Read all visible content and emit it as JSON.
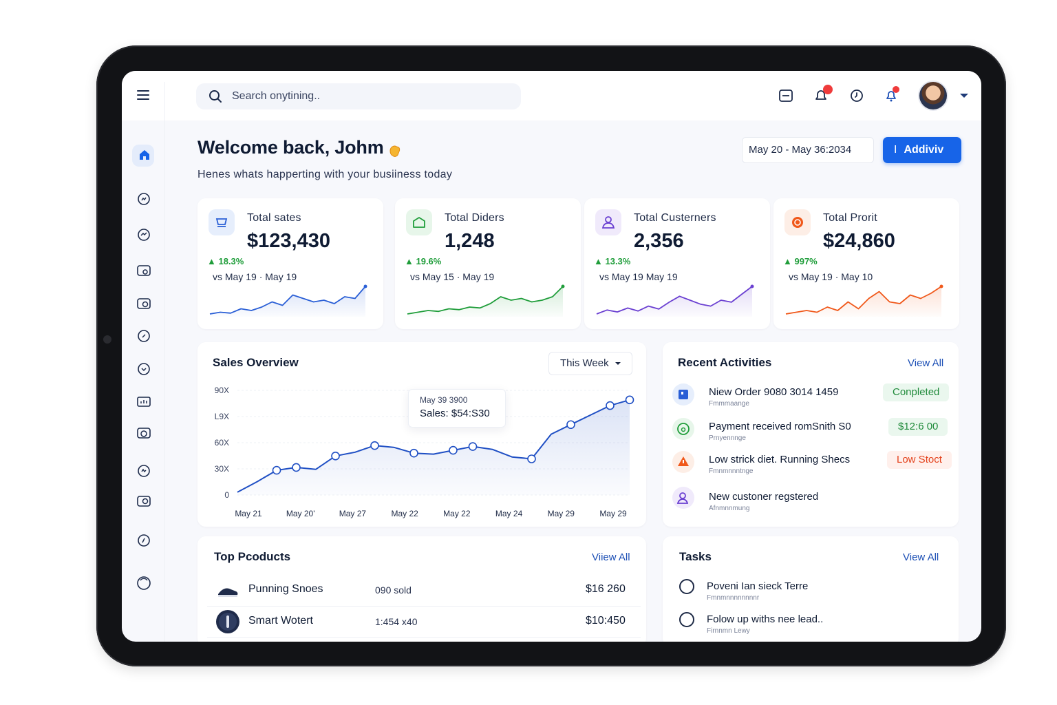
{
  "header": {
    "search_placeholder": "Search onytining..",
    "notification_colors": {
      "badge": "#ef3b3b"
    }
  },
  "welcome": {
    "title": "Welcome back, Johm",
    "subtitle": "Henes whats happerting with your busiiness today",
    "date_range": "May 20 - May 36:2034",
    "primary_button": "Addiviv",
    "primary_button_icon": "I"
  },
  "stats": [
    {
      "label": "Total sates",
      "value": "$123,430",
      "change": "▲ 18.3%",
      "compare": "vs May 19 · May 19",
      "color": "#2a5fd6",
      "icon": "cart-icon",
      "trend": [
        12,
        14,
        13,
        18,
        16,
        20,
        26,
        22,
        34,
        30,
        26,
        28,
        24,
        32,
        30,
        44
      ]
    },
    {
      "label": "Total Diders",
      "value": "1,248",
      "change": "▲ 19.6%",
      "compare": "vs May 15 · May 19",
      "color": "#1f9d3a",
      "icon": "box-icon",
      "trend": [
        10,
        12,
        14,
        13,
        16,
        15,
        18,
        17,
        22,
        30,
        26,
        28,
        24,
        26,
        30,
        42
      ]
    },
    {
      "label": "Total Custerners",
      "value": "2,356",
      "change": "▲ 13.3%",
      "compare": "vs May 19   May 19",
      "color": "#6a3fd1",
      "icon": "user-icon",
      "trend": [
        10,
        14,
        12,
        16,
        13,
        18,
        15,
        22,
        28,
        24,
        20,
        18,
        24,
        22,
        30,
        38
      ]
    },
    {
      "label": "Total Prorit",
      "value": "$24,860",
      "change": "▲ 997%",
      "compare": "vs May 19 · May 10",
      "color": "#f0581a",
      "icon": "coin-icon",
      "trend": [
        10,
        12,
        14,
        12,
        18,
        14,
        24,
        16,
        28,
        36,
        24,
        22,
        32,
        28,
        34,
        42
      ]
    }
  ],
  "sales_overview": {
    "title": "Sales Overview",
    "range_select": "This Week",
    "tooltip_date": "May 39 3900",
    "tooltip_value": "Sales: $54:S30"
  },
  "chart_data": {
    "type": "area",
    "y_tick_labels": [
      "0",
      "30X",
      "60X",
      "L9X",
      "90X"
    ],
    "x_tick_labels": [
      "May 21",
      "May 20'",
      "May 27",
      "May 22",
      "May 22",
      "May 24",
      "May 29",
      "May 29"
    ],
    "x": [
      0,
      1,
      2,
      3,
      4,
      5,
      6,
      7,
      8,
      9,
      10,
      11,
      12,
      13,
      14,
      15,
      16,
      17,
      18,
      19,
      20
    ],
    "values": [
      3,
      14,
      26,
      29,
      27,
      41,
      45,
      52,
      50,
      44,
      43,
      47,
      51,
      48,
      40,
      38,
      64,
      74,
      84,
      94,
      100
    ],
    "ylim": [
      0,
      110
    ],
    "color": "#1f4fc4",
    "grid": true
  },
  "activities": {
    "title": "Recent Activities",
    "view_all": "View All",
    "items": [
      {
        "title": "Niew Order 9080 3014 1459",
        "sub": "Fmmmaange",
        "badge": "Conpleted",
        "badge_color": "#1f8a3a",
        "badge_bg": "#eaf7ee",
        "icon": "order-icon",
        "icon_color": "#2a5fd6"
      },
      {
        "title": "Payment received romSnith S0",
        "sub": "Prnyennnge",
        "badge": "$12:6 00",
        "badge_color": "#1f8a3a",
        "badge_bg": "#eaf7ee",
        "icon": "payment-icon",
        "icon_color": "#1f9d3a"
      },
      {
        "title": "Low strick diet. Running Shecs",
        "sub": "Fmnmnnntnge",
        "badge": "Low Stoct",
        "badge_color": "#e4421c",
        "badge_bg": "#fff0ec",
        "icon": "warning-icon",
        "icon_color": "#f0581a"
      },
      {
        "title": "New custoner regstered",
        "sub": "Afnmnnmung",
        "badge": "",
        "badge_color": "",
        "badge_bg": "",
        "icon": "new-user-icon",
        "icon_color": "#6a3fd1"
      }
    ]
  },
  "products": {
    "title": "Top Pcoducts",
    "view_all": "Viiew All",
    "items": [
      {
        "name": "Punning Snoes",
        "sold": "090 sold",
        "price": "$16 260"
      },
      {
        "name": "Smart Wotert",
        "sold": "1:454 x40",
        "price": "$10:450"
      }
    ]
  },
  "tasks": {
    "title": "Tasks",
    "view_all": "View All",
    "items": [
      {
        "title": "Poveni Ian sieck Terre",
        "sub": "Fmnmnnnnnnnnr"
      },
      {
        "title": "Folow up withs nee lead..",
        "sub": "Firnnmn Lewy"
      }
    ]
  }
}
